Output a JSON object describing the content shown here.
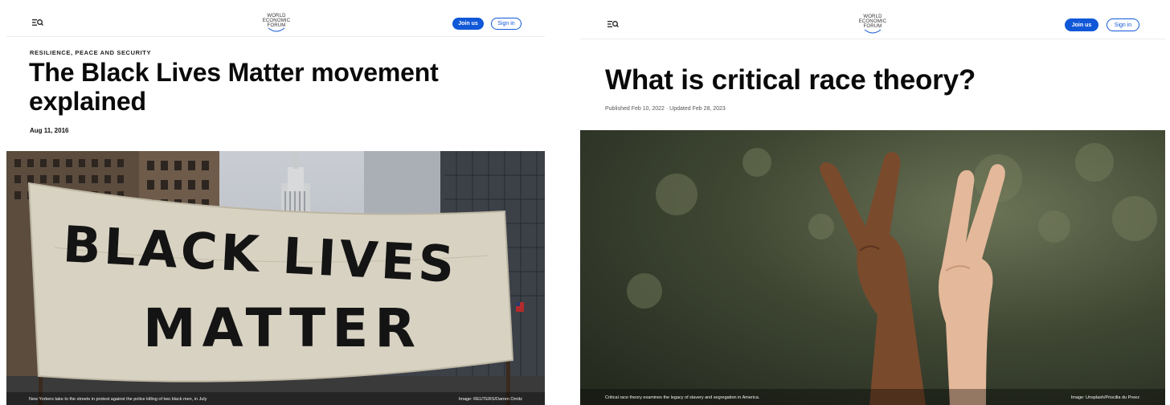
{
  "left_page": {
    "header": {
      "logo_lines": [
        "WORLD",
        "ECONOMIC",
        "FORUM"
      ],
      "join_label": "Join us",
      "signin_label": "Sign in"
    },
    "article": {
      "category": "RESILIENCE, PEACE AND SECURITY",
      "title": "The Black Lives Matter movement explained",
      "date": "Aug 11, 2016"
    },
    "hero": {
      "banner_text_line1": "BLACK LIVES",
      "banner_text_line2": "MATTER",
      "caption": "New Yorkers take to the streets in protest against the police killing of two black men, in July",
      "credit": "Image: REUTERS/Darren Ornitz"
    }
  },
  "right_page": {
    "header": {
      "logo_lines": [
        "WORLD",
        "ECONOMIC",
        "FORUM"
      ],
      "join_label": "Join us",
      "signin_label": "Sign in"
    },
    "article": {
      "title": "What is critical race theory?",
      "date": "Published Feb 10, 2022 · Updated Feb 28, 2023"
    },
    "hero": {
      "caption": "Critical race theory examines the legacy of slavery and segregation in America.",
      "credit": "Image: Unsplash/Priscilla du Preez"
    }
  },
  "colors": {
    "accent": "#1158d8",
    "title": "#0a0a0a"
  },
  "icons": [
    "menu-search-icon",
    "wef-logo-arc"
  ]
}
